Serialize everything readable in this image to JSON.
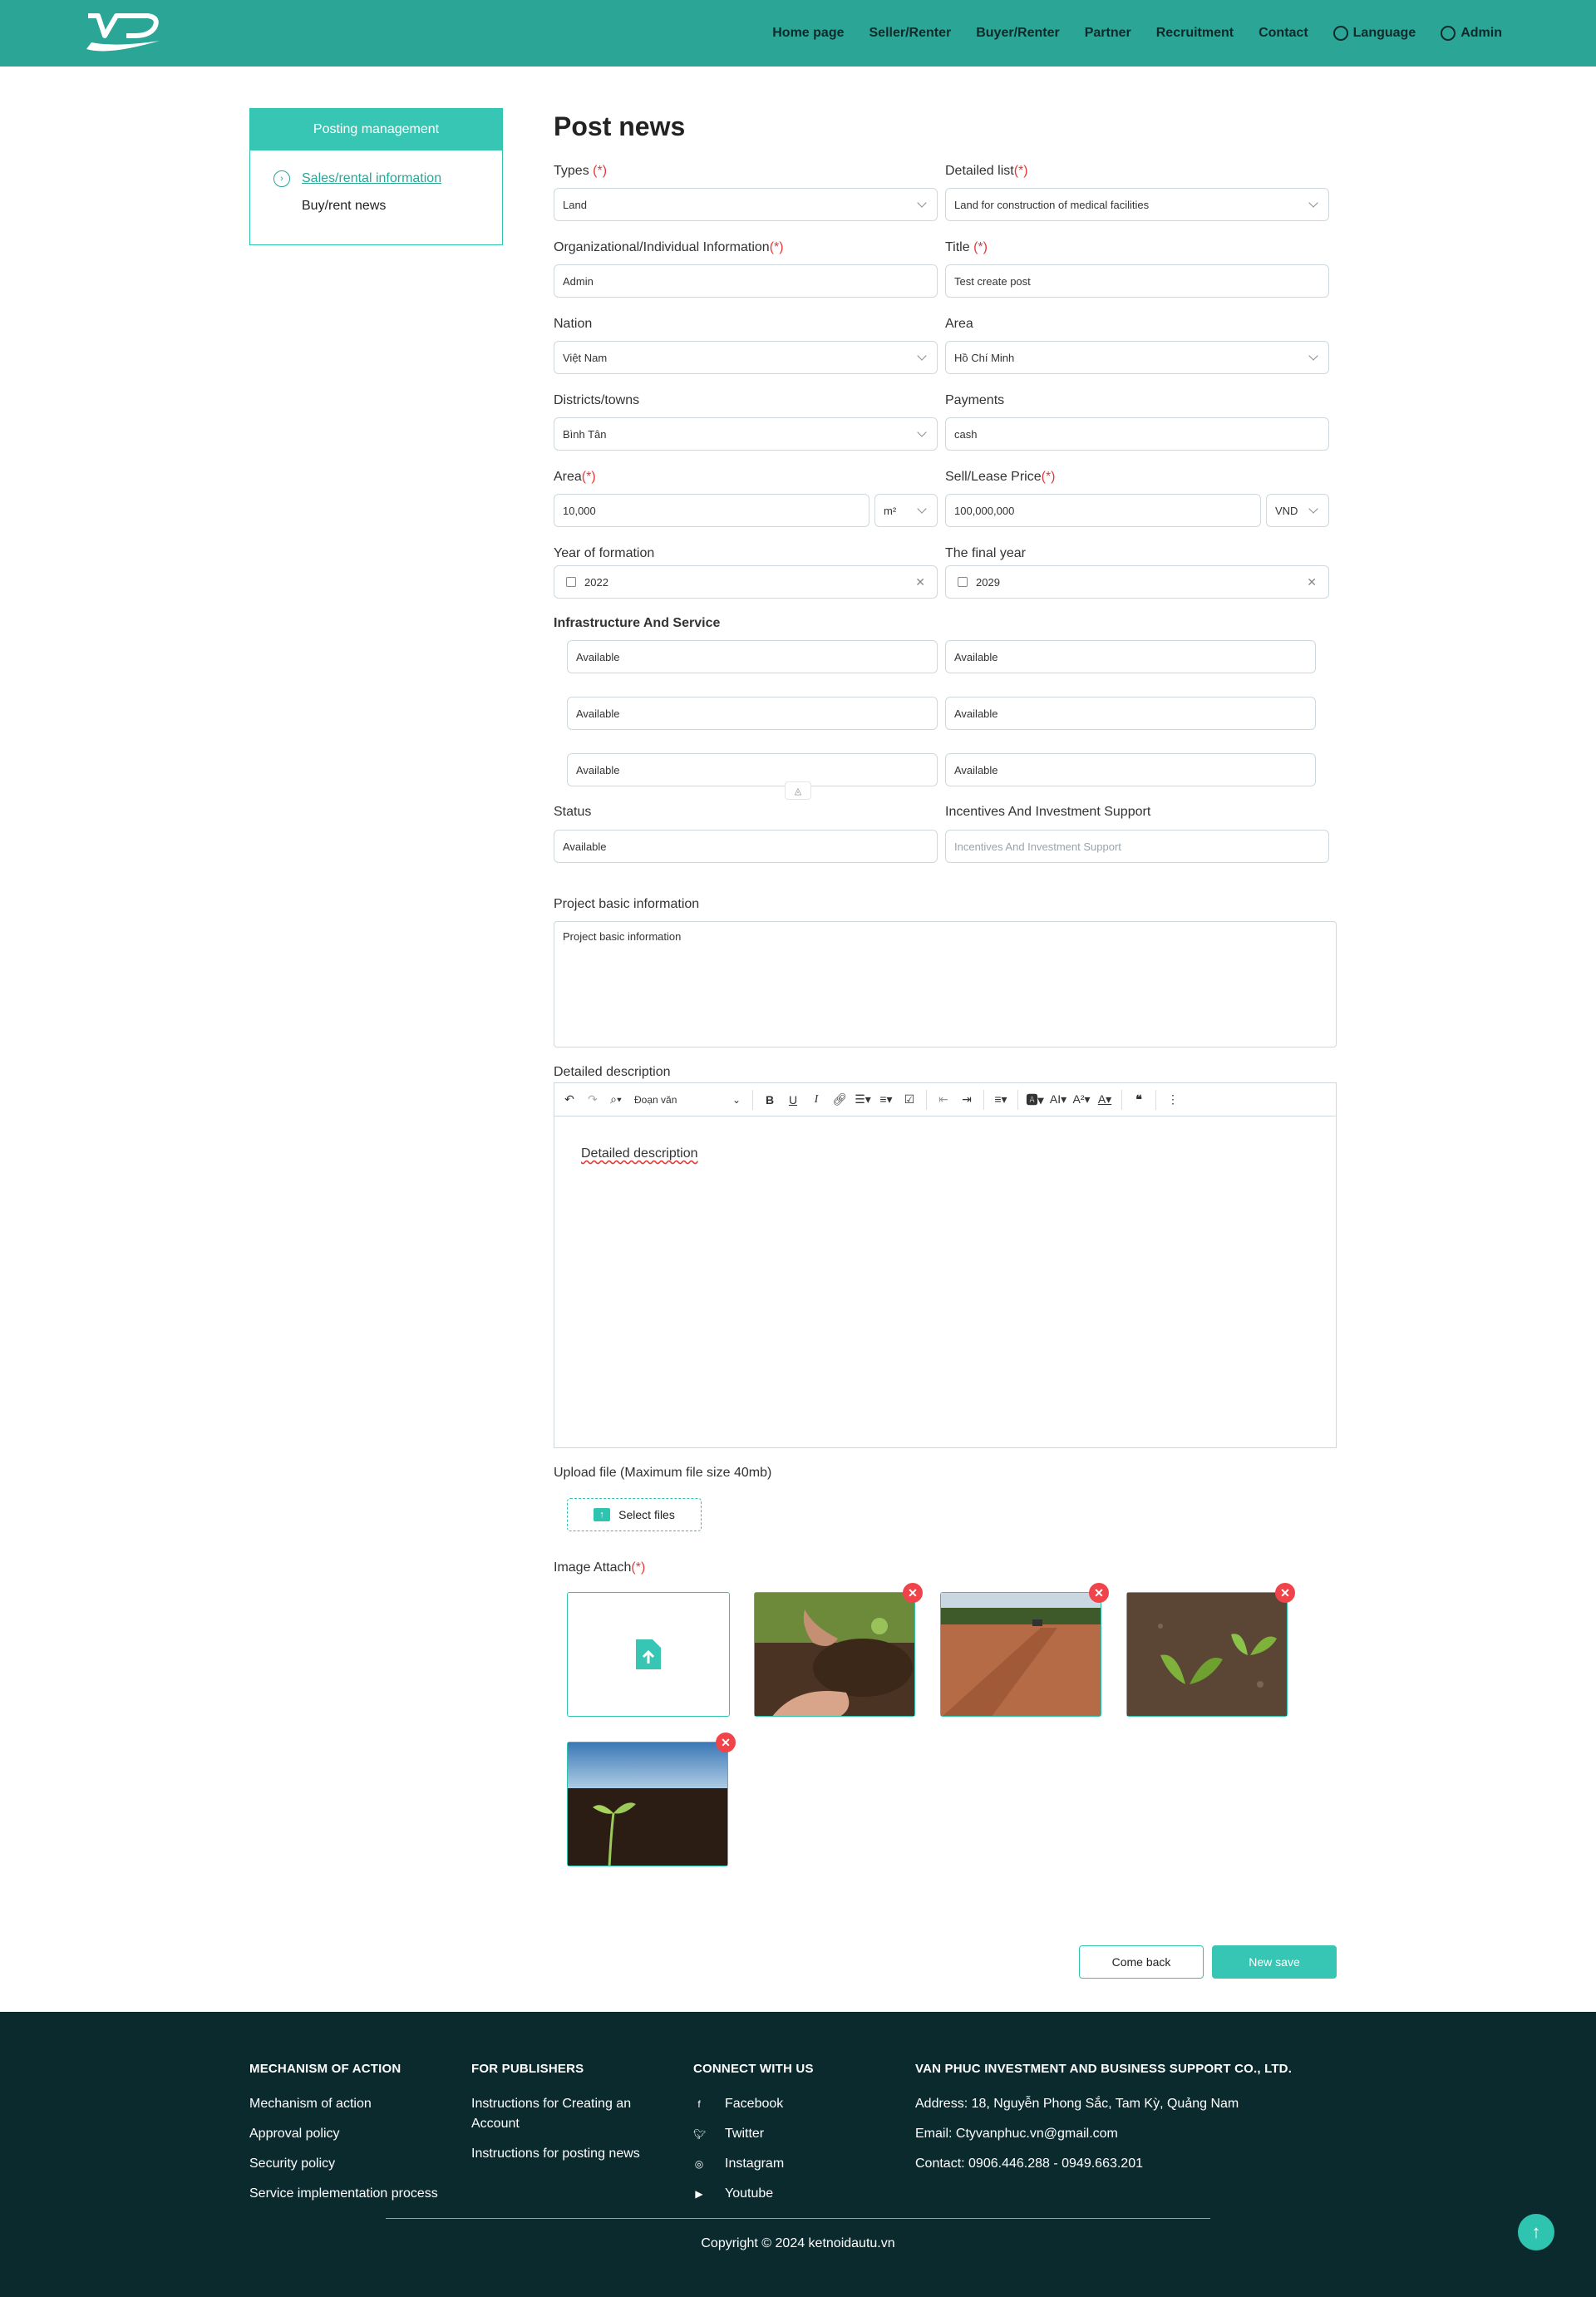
{
  "header": {
    "nav": [
      "Home page",
      "Seller/Renter",
      "Buyer/Renter",
      "Partner",
      "Recruitment",
      "Contact"
    ],
    "language": "Language",
    "admin": "Admin",
    "colors": {
      "brand": "#2aa596"
    }
  },
  "sidebar": {
    "title": "Posting management",
    "items": [
      {
        "label": "Sales/rental information",
        "active": true
      },
      {
        "label": "Buy/rent news",
        "active": false
      }
    ]
  },
  "form": {
    "page_title": "Post news",
    "required_mark": "(*)",
    "types": {
      "label": "Types",
      "value": "Land"
    },
    "detailed_list": {
      "label": "Detailed list",
      "value": "Land for construction of medical facilities"
    },
    "org_info": {
      "label": "Organizational/Individual Information",
      "value": "Admin"
    },
    "title": {
      "label": "Title",
      "value": "Test create post"
    },
    "nation": {
      "label": "Nation",
      "value": "Việt Nam"
    },
    "area_region": {
      "label": "Area",
      "value": "Hồ Chí Minh"
    },
    "districts": {
      "label": "Districts/towns",
      "value": "Bình Tân"
    },
    "payments": {
      "label": "Payments",
      "value": "cash"
    },
    "area_size": {
      "label": "Area",
      "value": "10,000",
      "unit": "m²"
    },
    "price": {
      "label": "Sell/Lease Price",
      "value": "100,000,000",
      "currency": "VND"
    },
    "year_formation": {
      "label": "Year of formation",
      "value": "2022"
    },
    "final_year": {
      "label": "The final year",
      "value": "2029"
    },
    "infrastructure": {
      "label": "Infrastructure And Service",
      "values": [
        "Available",
        "Available",
        "Available",
        "Available",
        "Available",
        "Available"
      ]
    },
    "status": {
      "label": "Status",
      "value": "Available"
    },
    "incentives": {
      "label": "Incentives And Investment Support",
      "placeholder": "Incentives And Investment Support"
    },
    "project_info": {
      "label": "Project basic information",
      "value": "Project basic information"
    },
    "detailed_description": {
      "label": "Detailed description",
      "content": "Detailed description",
      "heading_select": "Đoạn văn"
    },
    "upload": {
      "label": "Upload file (Maximum file size 40mb)",
      "button": "Select files"
    },
    "image_attach": {
      "label": "Image Attach"
    },
    "buttons": {
      "back": "Come back",
      "save": "New save"
    }
  },
  "footer": {
    "col1": {
      "title": "MECHANISM OF ACTION",
      "links": [
        "Mechanism of action",
        "Approval policy",
        "Security policy",
        "Service implementation process"
      ]
    },
    "col2": {
      "title": "FOR PUBLISHERS",
      "links": [
        "Instructions for Creating an Account",
        "Instructions for posting news"
      ]
    },
    "col3": {
      "title": "CONNECT WITH US",
      "links": [
        "Facebook",
        "Twitter",
        "Instagram",
        "Youtube"
      ]
    },
    "col4": {
      "title": "VAN PHUC INVESTMENT AND BUSINESS SUPPORT CO., LTD.",
      "address": "Address: 18, Nguyễn Phong Sắc, Tam Kỳ, Quảng Nam",
      "email": "Email: Ctyvanphuc.vn@gmail.com",
      "contact": "Contact: 0906.446.288 - 0949.663.201"
    },
    "copyright": "Copyright © 2024 ketnoidautu.vn"
  }
}
